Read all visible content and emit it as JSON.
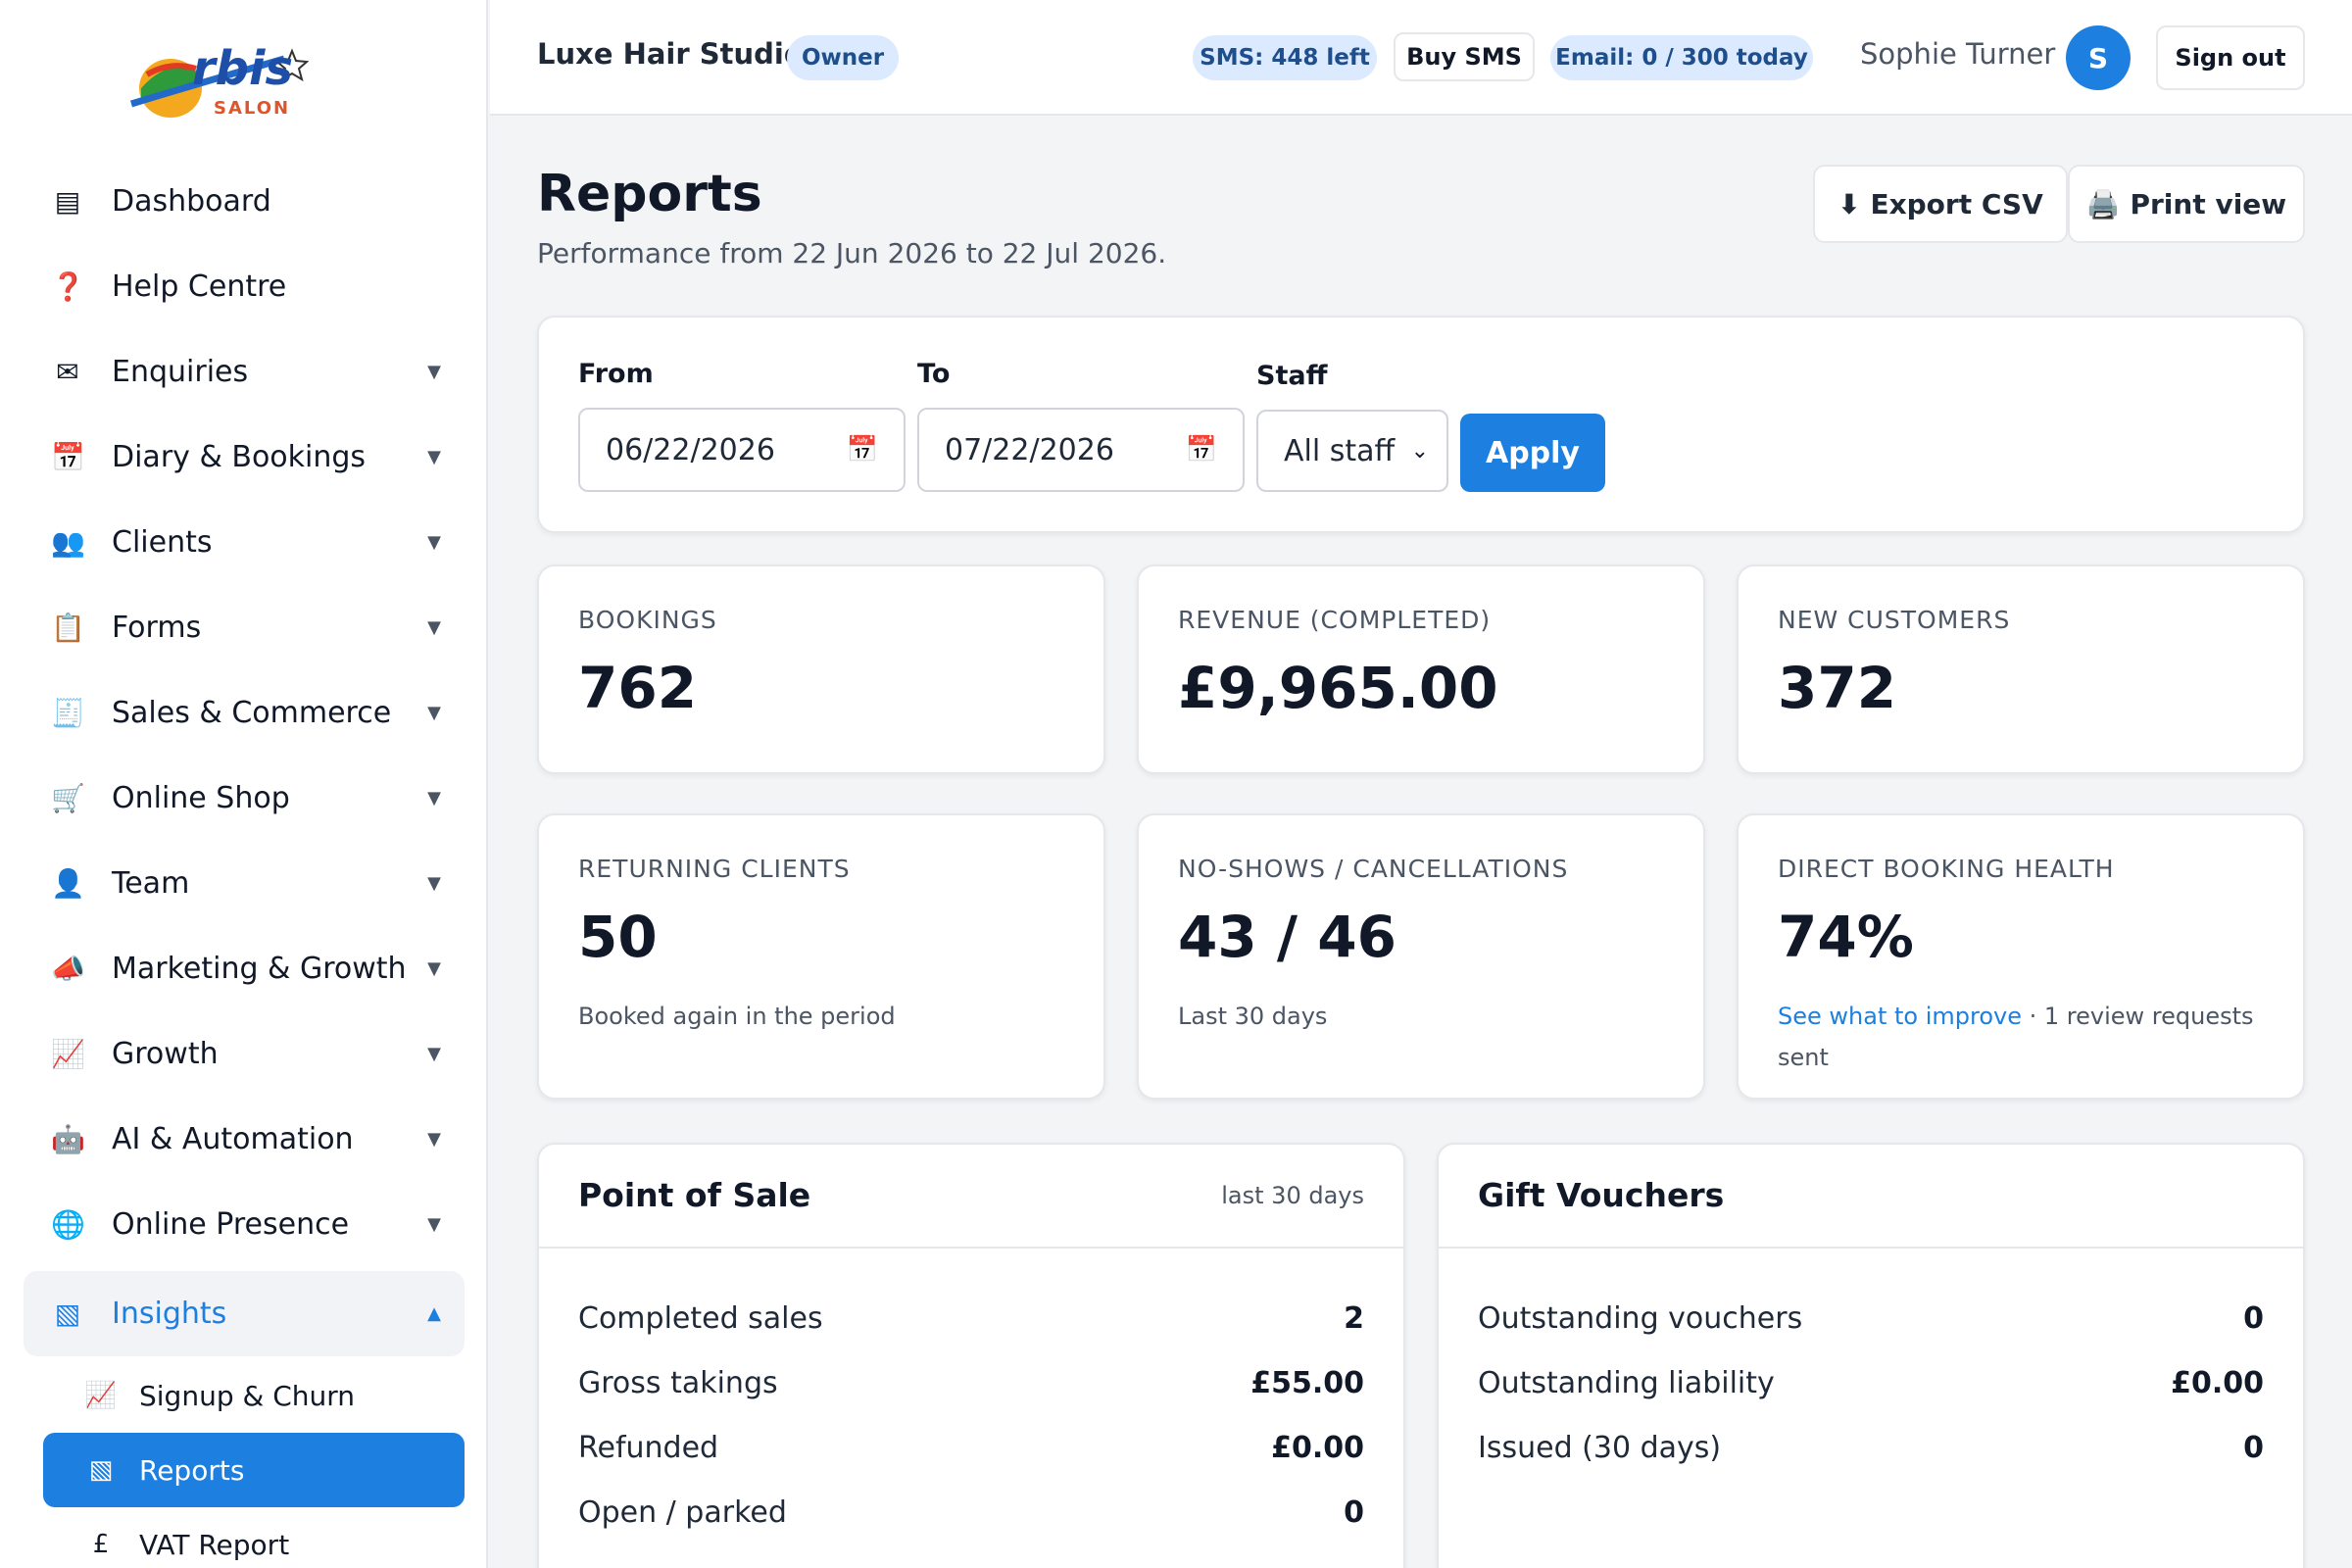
{
  "brand": {
    "logo_text": "rbis",
    "logo_initial": "O",
    "logo_sub": "SALON"
  },
  "sidebar": {
    "items": [
      {
        "label": "Dashboard",
        "icon": "▤",
        "caret": ""
      },
      {
        "label": "Help Centre",
        "icon": "❓",
        "caret": ""
      },
      {
        "label": "Enquiries",
        "icon": "✉",
        "caret": "▼"
      },
      {
        "label": "Diary & Bookings",
        "icon": "📅",
        "caret": "▼"
      },
      {
        "label": "Clients",
        "icon": "👥",
        "caret": "▼"
      },
      {
        "label": "Forms",
        "icon": "📋",
        "caret": "▼"
      },
      {
        "label": "Sales & Commerce",
        "icon": "🧾",
        "caret": "▼"
      },
      {
        "label": "Online Shop",
        "icon": "🛒",
        "caret": "▼"
      },
      {
        "label": "Team",
        "icon": "👤",
        "caret": "▼"
      },
      {
        "label": "Marketing & Growth",
        "icon": "📣",
        "caret": "▼"
      },
      {
        "label": "Growth",
        "icon": "📈",
        "caret": "▼"
      },
      {
        "label": "AI & Automation",
        "icon": "🤖",
        "caret": "▼"
      },
      {
        "label": "Online Presence",
        "icon": "🌐",
        "caret": "▼"
      }
    ],
    "open_item": {
      "label": "Insights",
      "icon": "▧",
      "caret": "▲"
    },
    "sub_items": [
      {
        "label": "Signup & Churn",
        "icon": "📈"
      },
      {
        "label": "Reports",
        "icon": "▧"
      },
      {
        "label": "VAT Report",
        "icon": "£"
      }
    ]
  },
  "header": {
    "studio": "Luxe Hair Studio",
    "role": "Owner",
    "sms": "SMS: 448 left",
    "buy_sms": "Buy SMS",
    "email": "Email: 0 / 300 today",
    "user": "Sophie Turner",
    "avatar": "S",
    "sign_out": "Sign out"
  },
  "page": {
    "title": "Reports",
    "subtitle": "Performance from 22 Jun 2026 to 22 Jul 2026.",
    "export": "⬇ Export CSV",
    "print": "🖨️ Print view"
  },
  "filters": {
    "from_label": "From",
    "from_value": "06/22/2026",
    "to_label": "To",
    "to_value": "07/22/2026",
    "staff_label": "Staff",
    "staff_value": "All staff",
    "apply": "Apply"
  },
  "stats": [
    {
      "label": "BOOKINGS",
      "value": "762",
      "note": ""
    },
    {
      "label": "REVENUE (COMPLETED)",
      "value": "£9,965.00",
      "note": ""
    },
    {
      "label": "NEW CUSTOMERS",
      "value": "372",
      "note": ""
    },
    {
      "label": "RETURNING CLIENTS",
      "value": "50",
      "note": "Booked again in the period"
    },
    {
      "label": "NO-SHOWS / CANCELLATIONS",
      "value": "43 / 46",
      "note": "Last 30 days"
    },
    {
      "label": "DIRECT BOOKING HEALTH",
      "value": "74%",
      "link": "See what to improve",
      "note": " · 1 review requests sent"
    }
  ],
  "pos": {
    "title": "Point of Sale",
    "meta": "last 30 days",
    "rows": [
      {
        "label": "Completed sales",
        "value": "2"
      },
      {
        "label": "Gross takings",
        "value": "£55.00"
      },
      {
        "label": "Refunded",
        "value": "£0.00"
      },
      {
        "label": "Open / parked",
        "value": "0"
      }
    ]
  },
  "vouchers": {
    "title": "Gift Vouchers",
    "rows": [
      {
        "label": "Outstanding vouchers",
        "value": "0"
      },
      {
        "label": "Outstanding liability",
        "value": "£0.00"
      },
      {
        "label": "Issued (30 days)",
        "value": "0"
      }
    ]
  },
  "colors": {
    "accent": "#1d7fe0",
    "pill_bg": "#dbeafe",
    "pill_text": "#1e4e8c"
  }
}
